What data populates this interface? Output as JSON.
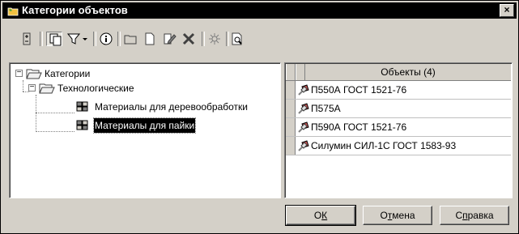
{
  "window": {
    "title": "Категории объектов",
    "close_label": "×"
  },
  "toolbar": {
    "buttons": [
      {
        "icon": "tree-expand-icon"
      },
      {
        "icon": "copy-icon"
      },
      {
        "icon": "filter-icon"
      },
      {
        "icon": "info-icon"
      },
      {
        "icon": "folder-icon"
      },
      {
        "icon": "new-document-icon"
      },
      {
        "icon": "edit-icon"
      },
      {
        "icon": "delete-icon"
      },
      {
        "icon": "special-icon"
      },
      {
        "icon": "preview-icon"
      }
    ]
  },
  "tree": {
    "nodes": [
      {
        "label": "Категории",
        "expander": "−"
      },
      {
        "label": "Технологические",
        "expander": "−"
      },
      {
        "label": "Материалы для деревообработки"
      },
      {
        "label": "Материалы для пайки"
      }
    ]
  },
  "table": {
    "header": "Объекты (4)",
    "rows": [
      {
        "name": "П550А ГОСТ 1521-76"
      },
      {
        "name": "П575А"
      },
      {
        "name": "П590А ГОСТ 1521-76"
      },
      {
        "name": "Силумин СИЛ-1С ГОСТ 1583-93"
      }
    ]
  },
  "buttons": {
    "ok_prefix": "О",
    "ok_underlined": "К",
    "ok_suffix": "",
    "cancel_prefix": "О",
    "cancel_underlined": "т",
    "cancel_suffix": "мена",
    "help_prefix": "С",
    "help_underlined": "п",
    "help_suffix": "равка"
  }
}
